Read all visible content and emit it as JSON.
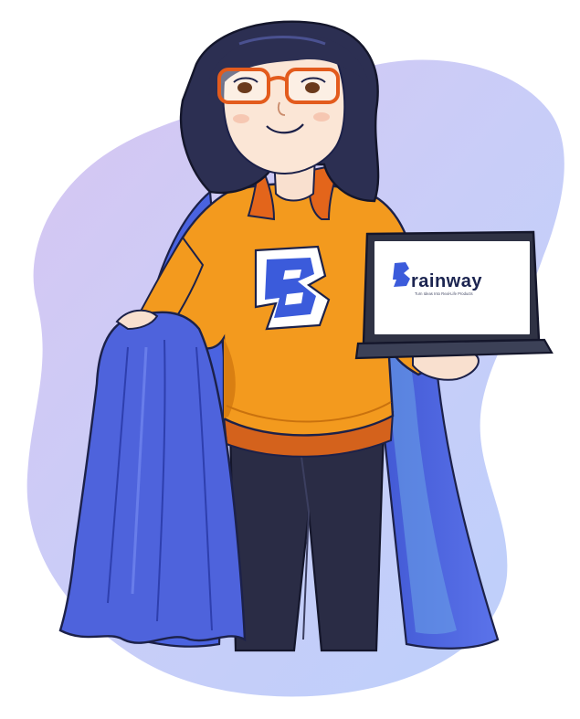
{
  "illustration": {
    "subject": "superhero-developer",
    "colors": {
      "blob": "#c7cffa",
      "sweater": "#f39a1e",
      "cape": "#4f66e0",
      "hair": "#2c2f52",
      "pants": "#2a2c45",
      "brand": "#3b5bdb"
    }
  },
  "laptop": {
    "brand_name": "rainway",
    "brand_letter": "B",
    "tagline": "Turn Ideas Into Real-Life Products"
  },
  "sweater": {
    "logo_letter": "B"
  }
}
